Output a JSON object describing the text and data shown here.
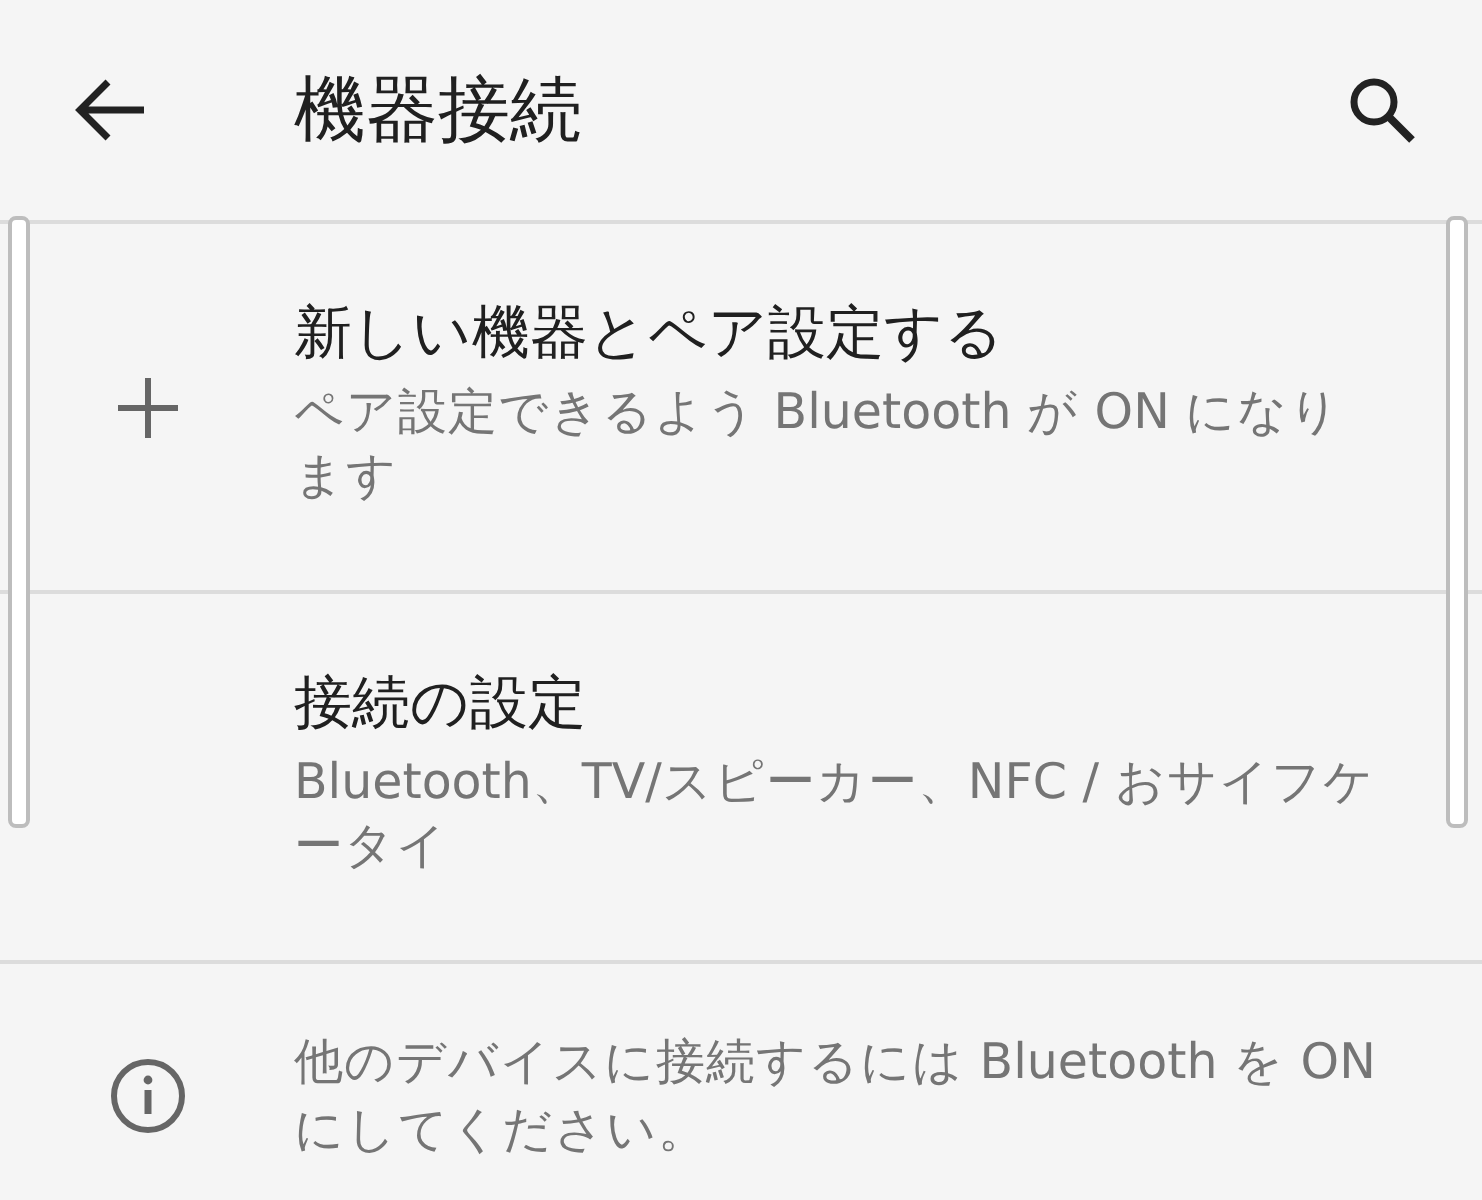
{
  "app_bar": {
    "title": "機器接続"
  },
  "items": [
    {
      "kind": "add",
      "title": "新しい機器とペア設定する",
      "summary": "ペア設定できるよう Bluetooth が ON になります"
    },
    {
      "kind": "plain",
      "title": "接続の設定",
      "summary": "Bluetooth、TV/スピーカー、NFC / おサイフケータイ"
    }
  ],
  "footer": {
    "text": "他のデバイスに接続するには Bluetooth を ON にしてください。"
  }
}
